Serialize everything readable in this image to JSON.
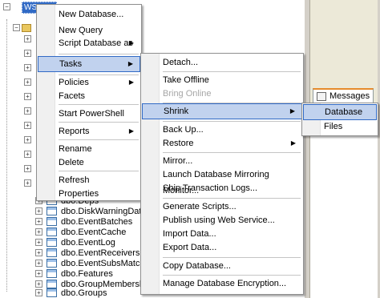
{
  "explorer": {
    "root_label": "WSS_CONF",
    "tables": [
      "dbo.Deps",
      "dbo.DiskWarningDate",
      "dbo.EventBatches",
      "dbo.EventCache",
      "dbo.EventLog",
      "dbo.EventReceivers",
      "dbo.EventSubsMatches",
      "dbo.Features",
      "dbo.GroupMembership",
      "dbo.Groups"
    ]
  },
  "messages_tab": {
    "label": "Messages"
  },
  "context_menu": {
    "items": [
      "New Database...",
      "New Query",
      "Script Database as",
      "Tasks",
      "Policies",
      "Facets",
      "Start PowerShell",
      "Reports",
      "Rename",
      "Delete",
      "Refresh",
      "Properties"
    ]
  },
  "tasks_menu": {
    "items": [
      "Detach...",
      "Take Offline",
      "Bring Online",
      "Shrink",
      "Back Up...",
      "Restore",
      "Mirror...",
      "Launch Database Mirroring Monitor...",
      "Ship Transaction Logs...",
      "Generate Scripts...",
      "Publish using Web Service...",
      "Import Data...",
      "Export Data...",
      "Copy Database...",
      "Manage Database Encryption..."
    ]
  },
  "shrink_menu": {
    "items": [
      "Database",
      "Files"
    ]
  },
  "icons": {
    "submenu_arrow": "chevron-right-icon",
    "expander": "plus-box-icon",
    "table": "table-icon"
  }
}
